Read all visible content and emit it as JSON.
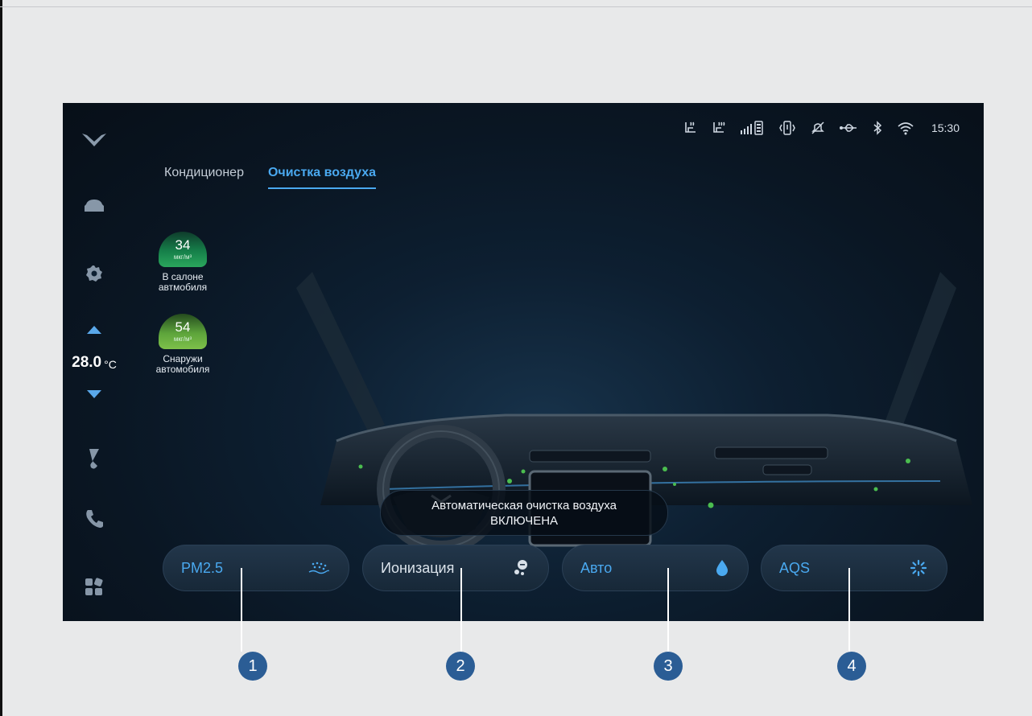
{
  "status_bar": {
    "time": "15:30",
    "icons": [
      "seat-heat-driver-icon",
      "seat-heat-passenger-icon",
      "signal-battery-icon",
      "vibration-icon",
      "mute-icon",
      "usb-icon",
      "bluetooth-icon",
      "wifi-icon"
    ]
  },
  "sidebar": {
    "items": [
      "logo-icon",
      "car-icon",
      "settings-icon",
      "temp-up-icon",
      "temp-down-icon",
      "fan-icon",
      "phone-icon",
      "apps-icon"
    ],
    "temperature": "28.0",
    "temperature_unit": "°C"
  },
  "tabs": [
    {
      "label": "Кондиционер",
      "active": false
    },
    {
      "label": "Очистка воздуха",
      "active": true
    }
  ],
  "air_quality": [
    {
      "value": "34",
      "unit": "мкг/м³",
      "label_line1": "В салоне",
      "label_line2": "автмобиля",
      "color": "#1f9a55"
    },
    {
      "value": "54",
      "unit": "мкг/м³",
      "label_line1": "Снаружи",
      "label_line2": "автомобиля",
      "color": "#6cb542"
    }
  ],
  "status_message": {
    "line1": "Автоматическая очистка воздуха",
    "line2": "ВКЛЮЧЕНА"
  },
  "modes": [
    {
      "label": "PM2.5",
      "icon": "pm-particles-icon",
      "active": true
    },
    {
      "label": "Ионизация",
      "icon": "ionization-icon",
      "active": false
    },
    {
      "label": "Авто",
      "icon": "water-drop-icon",
      "active": true
    },
    {
      "label": "AQS",
      "icon": "aqs-sparkle-icon",
      "active": true
    }
  ],
  "callouts": [
    "1",
    "2",
    "3",
    "4"
  ],
  "colors": {
    "accent": "#4aa9f0",
    "background": "#0a1623",
    "callout": "#2b5d95"
  }
}
